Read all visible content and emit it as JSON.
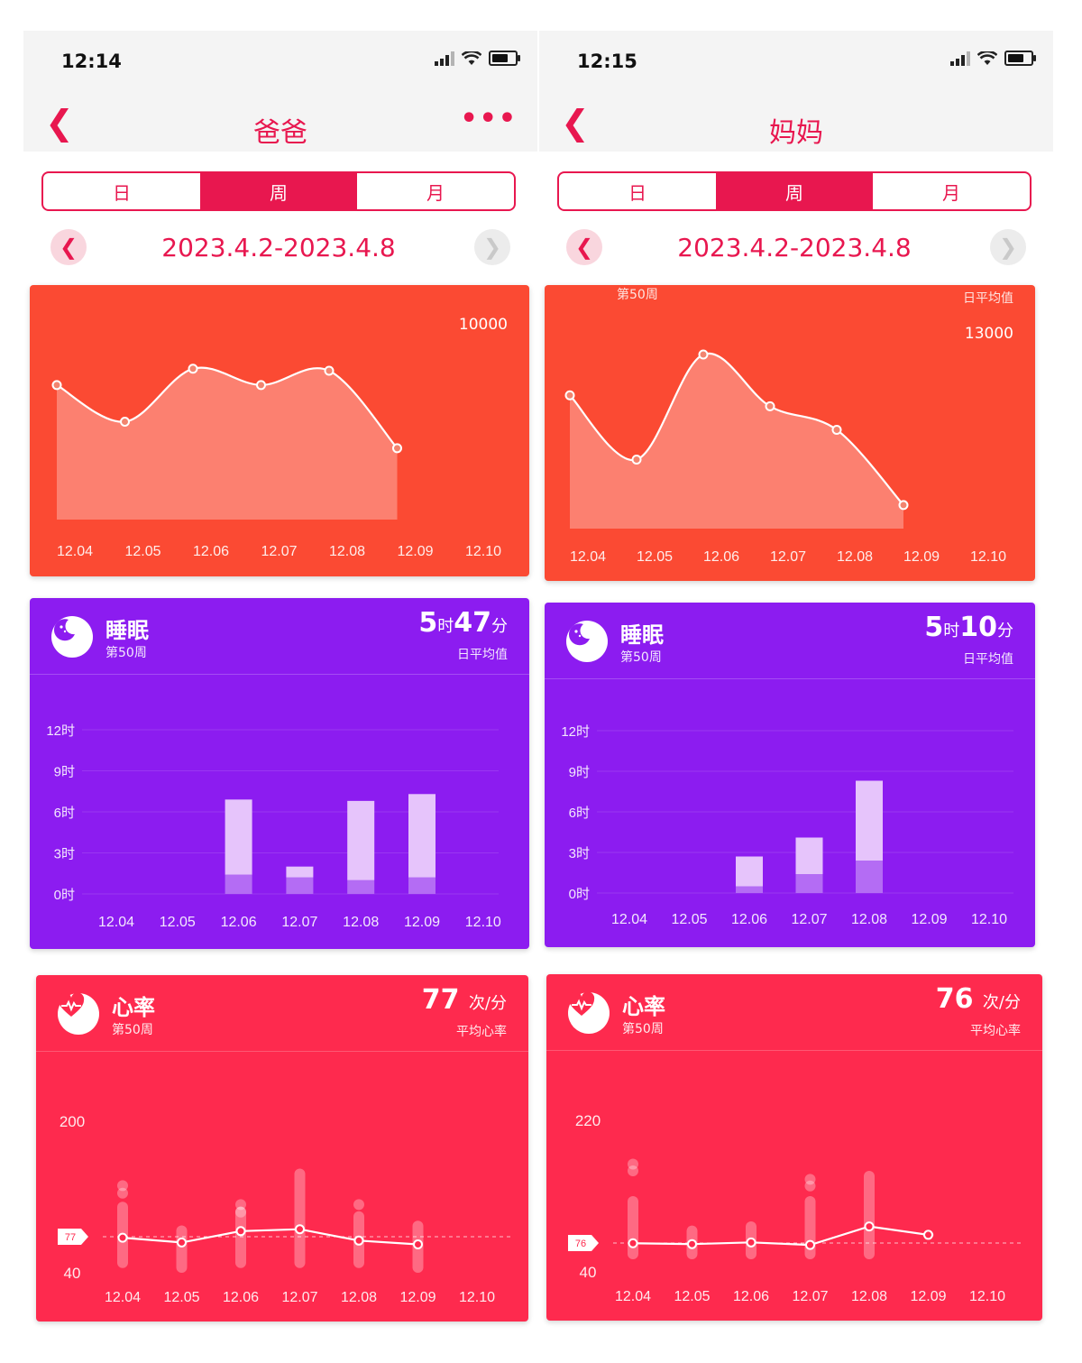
{
  "phones": [
    {
      "time": "12:14",
      "title": "爸爸",
      "more": "•••",
      "tabs": [
        "日",
        "周",
        "月"
      ],
      "active_tab": "周",
      "date_range": "2023.4.2-2023.4.8",
      "steps": {
        "week": "",
        "avg_label": "",
        "max_label": "10000",
        "x_labels": [
          "12.04",
          "12.05",
          "12.06",
          "12.07",
          "12.08",
          "12.09",
          "12.10"
        ],
        "values": [
          6600,
          4800,
          7400,
          6600,
          7300,
          3500
        ]
      },
      "sleep": {
        "title": "睡眠",
        "week": "第50周",
        "value_h": "5",
        "unit_h": "时",
        "value_m": "47",
        "unit_m": "分",
        "avg_label": "日平均值",
        "y_labels": [
          "12时",
          "9时",
          "6时",
          "3时",
          "0时"
        ],
        "x_labels": [
          "12.04",
          "12.05",
          "12.06",
          "12.07",
          "12.08",
          "12.09",
          "12.10"
        ],
        "light_hours": [
          null,
          null,
          5.5,
          0.8,
          5.8,
          6.1,
          null
        ],
        "deep_hours": [
          null,
          null,
          1.4,
          1.2,
          1.0,
          1.2,
          null
        ]
      },
      "heart": {
        "title": "心率",
        "week": "第50周",
        "value": "77",
        "unit": "次/分",
        "avg_label": "平均心率",
        "ymax_label": "200",
        "ymin_label": "40",
        "avg_tag": "77",
        "x_labels": [
          "12.04",
          "12.05",
          "12.06",
          "12.07",
          "12.08",
          "12.09",
          "12.10"
        ],
        "avg_values": [
          77,
          72,
          84,
          86,
          74,
          70
        ],
        "ranges": [
          [
            45,
            115
          ],
          [
            40,
            90
          ],
          [
            45,
            110
          ],
          [
            45,
            150
          ],
          [
            45,
            105
          ],
          [
            40,
            95
          ]
        ],
        "dots": [
          [
            124,
            132
          ],
          [],
          [
            104,
            112
          ],
          [],
          [
            112
          ],
          []
        ]
      }
    },
    {
      "time": "12:15",
      "title": "妈妈",
      "more": "",
      "tabs": [
        "日",
        "周",
        "月"
      ],
      "active_tab": "周",
      "date_range": "2023.4.2-2023.4.8",
      "steps": {
        "week": "第50周",
        "avg_label": "日平均值",
        "max_label": "13000",
        "x_labels": [
          "12.04",
          "12.05",
          "12.06",
          "12.07",
          "12.08",
          "12.09",
          "12.10"
        ],
        "values": [
          8500,
          4400,
          11100,
          7800,
          6300,
          1500
        ]
      },
      "sleep": {
        "title": "睡眠",
        "week": "第50周",
        "value_h": "5",
        "unit_h": "时",
        "value_m": "10",
        "unit_m": "分",
        "avg_label": "日平均值",
        "y_labels": [
          "12时",
          "9时",
          "6时",
          "3时",
          "0时"
        ],
        "x_labels": [
          "12.04",
          "12.05",
          "12.06",
          "12.07",
          "12.08",
          "12.09",
          "12.10"
        ],
        "light_hours": [
          null,
          null,
          2.2,
          2.7,
          5.9,
          null,
          null
        ],
        "deep_hours": [
          null,
          null,
          0.5,
          1.4,
          2.4,
          null,
          null
        ]
      },
      "heart": {
        "title": "心率",
        "week": "第50周",
        "value": "76",
        "unit": "次/分",
        "avg_label": "平均心率",
        "ymax_label": "220",
        "ymin_label": "40",
        "avg_tag": "76",
        "x_labels": [
          "12.04",
          "12.05",
          "12.06",
          "12.07",
          "12.08",
          "12.09",
          "12.10"
        ],
        "avg_values": [
          74,
          73,
          75,
          72,
          94,
          84
        ],
        "ranges": [
          [
            55,
            130
          ],
          [
            55,
            95
          ],
          [
            55,
            100
          ],
          [
            55,
            130
          ],
          [
            55,
            160
          ],
          [
            80,
            88
          ]
        ],
        "dots": [
          [
            160,
            168
          ],
          [],
          [],
          [
            142,
            150
          ],
          [],
          []
        ]
      }
    }
  ],
  "colors": {
    "accent": "#e8174f",
    "steps_bg": "#fb4a33",
    "sleep_bg": "#8c1cf0",
    "heart_bg": "#fe2a4e"
  },
  "icons": {
    "back": "chevron-left-icon",
    "prev": "chevron-left-icon",
    "next": "chevron-right-icon",
    "sleep": "moon-icon",
    "heart": "heart-icon"
  }
}
